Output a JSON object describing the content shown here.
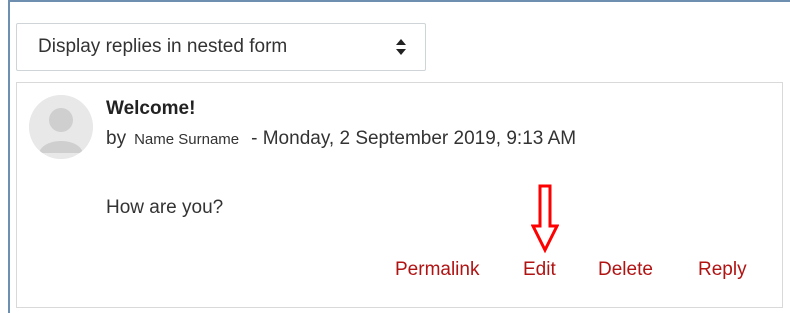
{
  "discussion": {
    "display_mode": {
      "selected": "Display replies in nested form"
    },
    "post": {
      "subject": "Welcome!",
      "by_prefix": "by",
      "author": "Name Surname",
      "date": "- Monday, 2 September 2019, 9:13 AM",
      "message": "How are you?",
      "commands": {
        "permalink": "Permalink",
        "edit": "Edit",
        "delete": "Delete",
        "reply": "Reply"
      }
    }
  },
  "colors": {
    "command_link": "#b11313",
    "annotation_arrow": "#ff0000"
  },
  "icons": {
    "avatar": "default-user-avatar-icon",
    "select_caret": "select-caret-icon",
    "annotation": "down-arrow-icon"
  }
}
